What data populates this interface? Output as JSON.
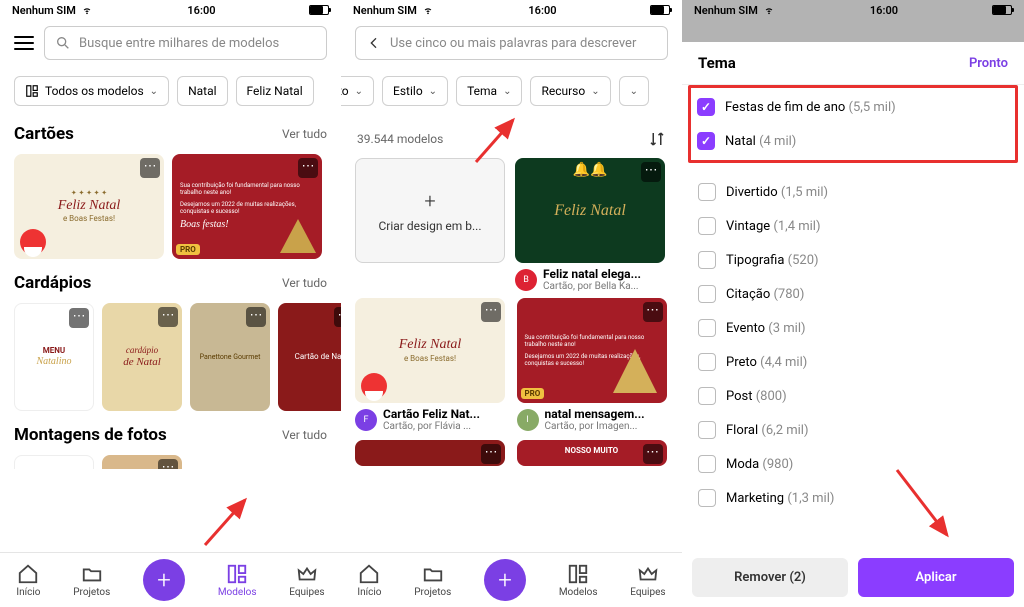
{
  "status": {
    "carrier": "Nenhum SIM",
    "time": "16:00"
  },
  "panel1": {
    "search_placeholder": "Busque entre milhares de modelos",
    "filters": {
      "all_models": "Todos os modelos",
      "chip_natal": "Natal",
      "chip_feliz": "Feliz Natal"
    },
    "sections": {
      "cartoes_title": "Cartões",
      "cardapios_title": "Cardápios",
      "montagens_title": "Montagens de fotos",
      "see_all": "Ver tudo"
    },
    "cards": {
      "card1_title": "Feliz Natal",
      "card1_sub": "e Boas Festas!",
      "card2_text": "Sua contribuição foi fundamental para nosso trabalho neste ano!",
      "card2_text2": "Desejamos um 2022 de muitas realizações, conquistas e sucesso!",
      "card2_sign": "Boas festas!",
      "menu_title": "MENU",
      "menu_sub": "Natalino",
      "cardapio_title": "cardápio",
      "cardapio_sub": "de Natal",
      "gourmet": "Panettone Gourmet",
      "cartao_n": "Cartão de Na"
    },
    "pro": "PRO"
  },
  "panel2": {
    "search_placeholder": "Use cinco ou mais palavras para descrever",
    "filters": {
      "partial_to": "to",
      "estilo": "Estilo",
      "tema": "Tema",
      "recurso": "Recurso"
    },
    "count_label": "39.544 modelos",
    "create_label": "Criar design em b...",
    "items": {
      "green_title": "Feliz Natal",
      "i1_title": "Feliz natal elega...",
      "i1_sub": "Cartão, por Bella Ka...",
      "i2a_title": "Cartão Feliz Nat...",
      "i2a_sub": "Cartão, por Flávia ...",
      "i2b_title": "natal mensagem...",
      "i2b_sub": "Cartão, por Imagen...",
      "nosso": "NOSSO MUITO"
    }
  },
  "panel3": {
    "title": "Tema",
    "done": "Pronto",
    "themes": [
      {
        "label": "Festas de fim de ano",
        "count": "(5,5 mil)",
        "checked": true
      },
      {
        "label": "Natal",
        "count": "(4 mil)",
        "checked": true
      },
      {
        "label": "Divertido",
        "count": "(1,5 mil)",
        "checked": false
      },
      {
        "label": "Vintage",
        "count": "(1,4 mil)",
        "checked": false
      },
      {
        "label": "Tipografia",
        "count": "(520)",
        "checked": false
      },
      {
        "label": "Citação",
        "count": "(780)",
        "checked": false
      },
      {
        "label": "Evento",
        "count": "(3 mil)",
        "checked": false
      },
      {
        "label": "Preto",
        "count": "(4,4 mil)",
        "checked": false
      },
      {
        "label": "Post",
        "count": "(800)",
        "checked": false
      },
      {
        "label": "Floral",
        "count": "(6,2 mil)",
        "checked": false
      },
      {
        "label": "Moda",
        "count": "(980)",
        "checked": false
      },
      {
        "label": "Marketing",
        "count": "(1,3 mil)",
        "checked": false
      }
    ],
    "remove": "Remover (2)",
    "apply": "Aplicar"
  },
  "nav": {
    "home": "Início",
    "projects": "Projetos",
    "models": "Modelos",
    "teams": "Equipes"
  }
}
